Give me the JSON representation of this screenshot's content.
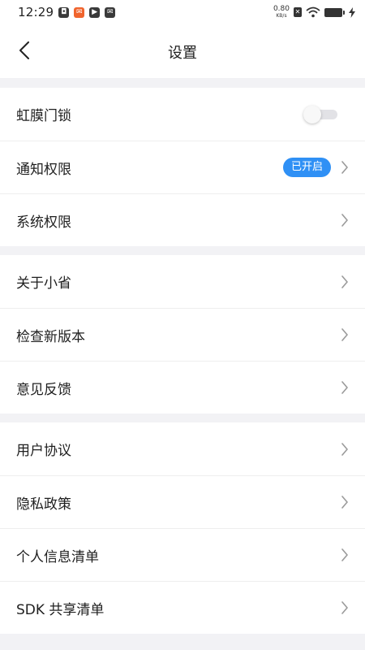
{
  "status_bar": {
    "time": "12:29",
    "net_speed_value": "0.80",
    "net_speed_unit": "KB/s",
    "notification_icons": [
      "app-notification-icon-1",
      "app-notification-icon-2",
      "app-notification-icon-3",
      "app-notification-icon-4"
    ],
    "right_icons": [
      "sim-icon",
      "wifi-icon",
      "battery-icon",
      "charging-icon"
    ]
  },
  "header": {
    "title": "设置",
    "back_icon": "chevron-left-icon"
  },
  "groups": [
    {
      "items": [
        {
          "label": "虹膜门锁",
          "control": "toggle",
          "toggle_on": false
        },
        {
          "label": "通知权限",
          "control": "badge",
          "badge": "已开启",
          "badge_color": "#2F90F5"
        },
        {
          "label": "系统权限",
          "control": "chevron"
        }
      ]
    },
    {
      "items": [
        {
          "label": "关于小省",
          "control": "chevron"
        },
        {
          "label": "检查新版本",
          "control": "chevron"
        },
        {
          "label": "意见反馈",
          "control": "chevron"
        }
      ]
    },
    {
      "items": [
        {
          "label": "用户协议",
          "control": "chevron"
        },
        {
          "label": "隐私政策",
          "control": "chevron"
        },
        {
          "label": "个人信息清单",
          "control": "chevron"
        },
        {
          "label": "SDK 共享清单",
          "control": "chevron"
        }
      ]
    }
  ],
  "colors": {
    "background": "#F2F2F5",
    "card": "#FFFFFF",
    "accent": "#2F90F5",
    "chevron": "#9A9A9A"
  }
}
